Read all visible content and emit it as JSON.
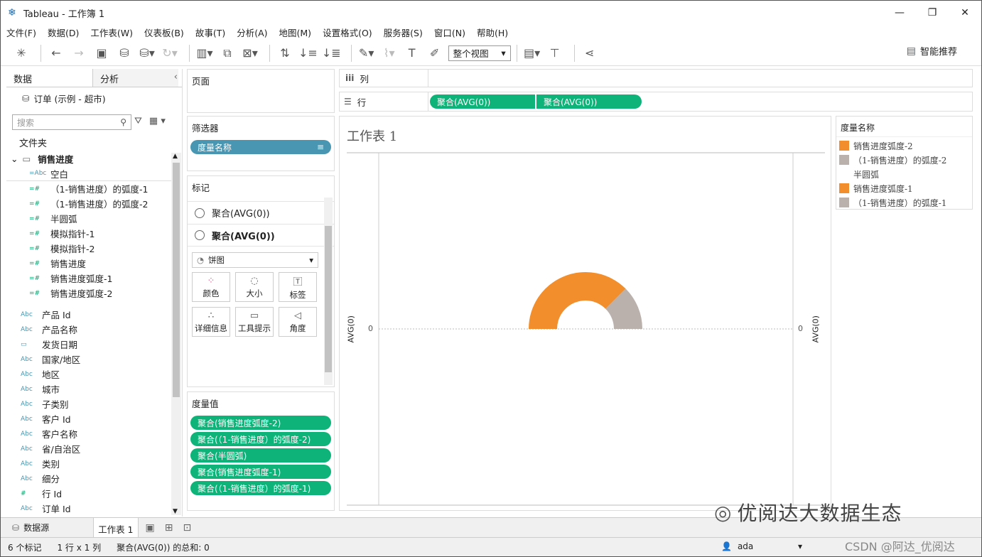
{
  "window": {
    "title": "Tableau - 工作簿 1",
    "min": "—",
    "max": "❐",
    "close": "✕"
  },
  "menu": [
    "文件(F)",
    "数据(D)",
    "工作表(W)",
    "仪表板(B)",
    "故事(T)",
    "分析(A)",
    "地图(M)",
    "设置格式(O)",
    "服务器(S)",
    "窗口(N)",
    "帮助(H)"
  ],
  "toolbar": {
    "fit": "整个视图",
    "smart": "智能推荐"
  },
  "left": {
    "tab_data": "数据",
    "tab_analysis": "分析",
    "datasource": "订单 (示例 - 超市)",
    "search_placeholder": "搜索",
    "folder": "文件夹",
    "group": "销售进度",
    "group_items": [
      {
        "icon": "=Abc",
        "label": "空白"
      },
      {
        "icon": "=#",
        "label": "（1-销售进度）的弧度-1"
      },
      {
        "icon": "=#",
        "label": "（1-销售进度）的弧度-2"
      },
      {
        "icon": "=#",
        "label": "半圆弧"
      },
      {
        "icon": "=#",
        "label": "模拟指针-1"
      },
      {
        "icon": "=#",
        "label": "模拟指针-2"
      },
      {
        "icon": "=#",
        "label": "销售进度"
      },
      {
        "icon": "=#",
        "label": "销售进度弧度-1"
      },
      {
        "icon": "=#",
        "label": "销售进度弧度-2"
      }
    ],
    "fields": [
      {
        "icon": "Abc",
        "label": "产品 Id"
      },
      {
        "icon": "Abc",
        "label": "产品名称"
      },
      {
        "icon": "▭",
        "label": "发货日期"
      },
      {
        "icon": "Abc",
        "label": "国家/地区"
      },
      {
        "icon": "Abc",
        "label": "地区"
      },
      {
        "icon": "Abc",
        "label": "城市"
      },
      {
        "icon": "Abc",
        "label": "子类别"
      },
      {
        "icon": "Abc",
        "label": "客户 Id"
      },
      {
        "icon": "Abc",
        "label": "客户名称"
      },
      {
        "icon": "Abc",
        "label": "省/自治区"
      },
      {
        "icon": "Abc",
        "label": "类别"
      },
      {
        "icon": "Abc",
        "label": "细分"
      },
      {
        "icon": "#",
        "label": "行 Id"
      },
      {
        "icon": "Abc",
        "label": "订单 Id"
      }
    ]
  },
  "shelves": {
    "pages": "页面",
    "filters": "筛选器",
    "filter_pill": "度量名称",
    "marks": "标记",
    "mark_rows": [
      "聚合(AVG(0))",
      "聚合(AVG(0))"
    ],
    "mark_type": "饼图",
    "mark_buttons": [
      {
        "icon": "●●",
        "label": "颜色"
      },
      {
        "icon": "○",
        "label": "大小"
      },
      {
        "icon": "T",
        "label": "标签"
      },
      {
        "icon": "∴",
        "label": "详细信息"
      },
      {
        "icon": "▭",
        "label": "工具提示"
      },
      {
        "icon": "◁",
        "label": "角度"
      }
    ],
    "measure_values": "度量值",
    "measure_pills": [
      "聚合(销售进度弧度-2)",
      "聚合(（1-销售进度）的弧度-2)",
      "聚合(半圆弧)",
      "聚合(销售进度弧度-1)",
      "聚合(（1-销售进度）的弧度-1)"
    ],
    "columns": "列",
    "columns_icon": "iii",
    "rows": "行",
    "rows_icon": "☰",
    "row_pills": [
      "聚合(AVG(0))",
      "聚合(AVG(0))"
    ]
  },
  "view": {
    "title": "工作表 1",
    "y_label": "AVG(0)",
    "tick_zero": "0"
  },
  "chart_data": {
    "type": "pie",
    "slices": [
      {
        "name": "销售进度弧度-2",
        "value": 0.75,
        "color": "#f28e2b"
      },
      {
        "name": "（1-销售进度）的弧度-2",
        "value": 0.25,
        "color": "#bab0ac"
      },
      {
        "name": "半圆弧",
        "value": 1,
        "color": "transparent"
      }
    ],
    "inner_hole": true,
    "ylim": [
      0,
      0
    ]
  },
  "legend": {
    "title": "度量名称",
    "items": [
      {
        "label": "销售进度弧度-2",
        "color": "#f28e2b"
      },
      {
        "label": "（1-销售进度）的弧度-2",
        "color": "#bab0ac"
      },
      {
        "label": "半圆弧",
        "color": "#ffffff"
      },
      {
        "label": "销售进度弧度-1",
        "color": "#f28e2b"
      },
      {
        "label": "（1-销售进度）的弧度-1",
        "color": "#bab0ac"
      }
    ]
  },
  "tabs": {
    "datasource": "数据源",
    "sheet": "工作表 1"
  },
  "status": {
    "marks": "6 个标记",
    "rows": "1 行 x 1 列",
    "sum": "聚合(AVG(0)) 的总和: 0",
    "user": "ada"
  },
  "watermark": {
    "main": "优阅达大数据生态",
    "csdn": "CSDN @阿达_优阅达"
  }
}
